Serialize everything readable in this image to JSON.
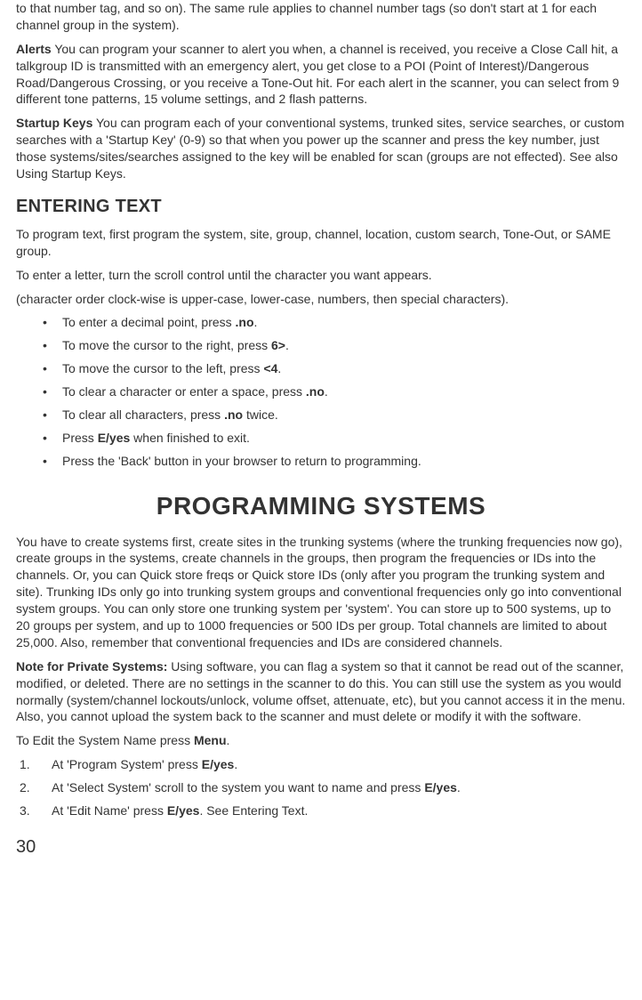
{
  "paras": {
    "p1": "to that number tag, and so on). The same rule applies to channel number tags (so don't start at 1 for each channel group in the system).",
    "p2_label": "Alerts",
    "p2_text": " You can program your scanner to alert you when, a channel is received, you receive a Close Call hit, a talkgroup ID is transmitted with an emergency alert, you get close to a POI (Point of Interest)/Dangerous Road/Dangerous Crossing, or you receive a Tone-Out hit. For each alert in the scanner, you can select from 9 different tone patterns, 15 volume settings, and 2 flash patterns.",
    "p3_label": "Startup Keys",
    "p3_text": " You can program each of your conventional systems, trunked sites, service searches, or custom searches with a 'Startup Key' (0-9) so that when you power up the scanner and press the key number, just those systems/sites/searches assigned to the key will be enabled for scan (groups are not effected). See also Using Startup Keys."
  },
  "heading_entering": "ENTERING TEXT",
  "entering": {
    "p1": "To program text, first program the system, site, group, channel, location, custom search, Tone-Out, or SAME group.",
    "p2": "To enter a letter, turn the scroll control until the character you want appears.",
    "p3": "(character order clock-wise is upper-case, lower-case, numbers, then special characters).",
    "bullets": {
      "b1a": "To enter a decimal point, press ",
      "b1b": ".no",
      "b1c": ".",
      "b2a": "To move the cursor to the right, press ",
      "b2b": "6>",
      "b2c": ".",
      "b3a": "To move the cursor to the left, press ",
      "b3b": "<4",
      "b3c": ".",
      "b4a": "To clear a character or enter a space, press ",
      "b4b": ".no",
      "b4c": ".",
      "b5a": "To clear all characters, press ",
      "b5b": ".no",
      "b5c": " twice.",
      "b6a": "Press ",
      "b6b": "E/yes",
      "b6c": " when finished to exit.",
      "b7": "Press the 'Back' button in your browser to return to programming."
    }
  },
  "heading_programming": "PROGRAMMING SYSTEMS",
  "programming": {
    "p1": "You have to create systems first, create sites in the trunking systems (where the trunking frequencies now go), create groups in the systems, create channels in the groups, then program the frequencies or IDs into the channels. Or, you can Quick store freqs or Quick store IDs (only after you program the trunking system and site). Trunking IDs only go into trunking system groups and conventional frequencies only go into conventional system groups. You can only store one trunking system per 'system'. You can store up to 500 systems, up to 20 groups per system, and up to 1000 frequencies or 500 IDs per group. Total channels are limited to about 25,000. Also, remember that conventional frequencies and IDs are considered channels.",
    "p2_label": "Note for Private Systems:",
    "p2_text": " Using software, you can flag a system so that it cannot be read out of the scanner, modified, or deleted. There are no settings in the scanner to do this. You can still use the system as you would normally (system/channel lockouts/unlock, volume offset, attenuate, etc), but you cannot access it in the menu. Also, you cannot upload the system back to the scanner and must delete or modify it with the software.",
    "p3a": "To Edit the System Name press ",
    "p3b": "Menu",
    "p3c": ".",
    "steps": {
      "s1a": "At 'Program System' press ",
      "s1b": "E/yes",
      "s1c": ".",
      "s2a": "At 'Select System' scroll to the system you want to name and press ",
      "s2b": "E/yes",
      "s2c": ".",
      "s3a": "At 'Edit Name' press ",
      "s3b": "E/yes",
      "s3c": ". See Entering Text."
    }
  },
  "page_number": "30"
}
